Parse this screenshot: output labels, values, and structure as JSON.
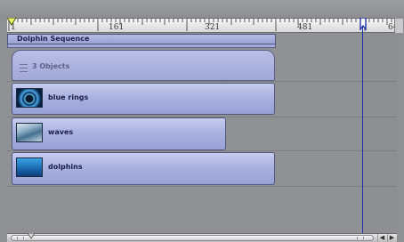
{
  "ruler": {
    "labels": [
      "1",
      "161",
      "321",
      "481",
      "64"
    ]
  },
  "sequence": {
    "label": "Dolphin Sequence"
  },
  "group": {
    "label": "3 Objects"
  },
  "tracks": [
    {
      "label": "blue rings",
      "thumbnail": "blue-rings-thumbnail"
    },
    {
      "label": "waves",
      "thumbnail": "waves-thumbnail"
    },
    {
      "label": "dolphins",
      "thumbnail": "dolphins-thumbnail"
    }
  ],
  "colors": {
    "bar_fill": "#a8b0e0",
    "playhead": "#2030a8",
    "timeline_bg": "#909194"
  }
}
